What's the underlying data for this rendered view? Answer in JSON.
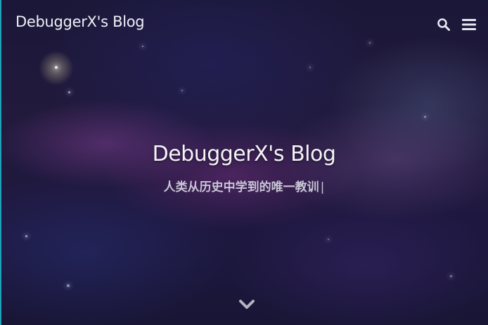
{
  "header": {
    "site_title": "DebuggerX's Blog",
    "icons": [
      "search-icon",
      "menu-icon"
    ]
  },
  "hero": {
    "title": "DebuggerX's Blog",
    "subtitle": "人类从历史中学到的唯一教训",
    "cursor": "|",
    "scroll_icon": "chevron-down-icon"
  },
  "colors": {
    "accent_edge": "#1fa2b8",
    "text_primary": "#f4f4f8",
    "text_secondary": "#c9c6d6",
    "icon": "#e6e8ef"
  }
}
